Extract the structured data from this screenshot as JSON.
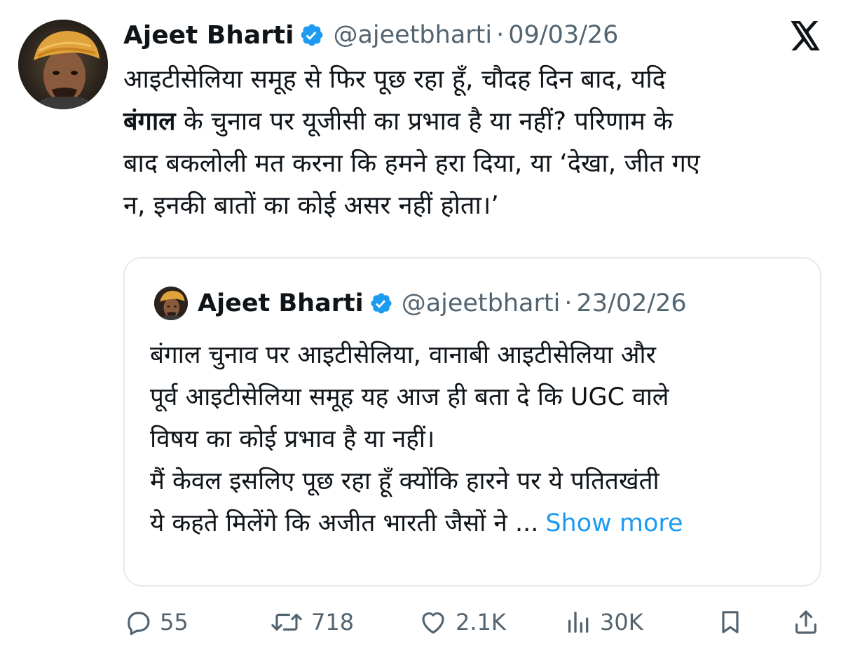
{
  "author": {
    "name": "Ajeet Bharti",
    "handle": "@ajeetbharti",
    "separator": "·",
    "date": "09/03/26"
  },
  "icons": {
    "avatar": "avatar",
    "verified": "verified-badge-icon",
    "platform": "x-logo-icon"
  },
  "colors": {
    "accent": "#1d9bf0",
    "muted": "#536471",
    "text": "#0f1419",
    "border": "#e6e9ec"
  },
  "tweet": {
    "line1": "आइटीसेलिया समूह से फिर पूछ रहा हूँ, चौदह दिन बाद, यदि",
    "line2_bold": "बंगाल",
    "line2_rest": " के चुनाव पर यूजीसी का प्रभाव है या नहीं? परिणाम के",
    "line3": "बाद बकलोली मत करना कि हमने हरा दिया, या ‘देखा, जीत गए",
    "line4": "न, इनकी बातों का कोई असर नहीं होता।’"
  },
  "quote": {
    "name": "Ajeet Bharti",
    "handle": "@ajeetbharti",
    "separator": "·",
    "date": "23/02/26",
    "lines": [
      "बंगाल चुनाव पर आइटीसेलिया, वानाबी आइटीसेलिया और",
      "पूर्व आइटीसेलिया समूह यह आज ही बता दे कि UGC वाले",
      "विषय का कोई प्रभाव है या नहीं।",
      "मैं केवल इसलिए पूछ रहा हूँ क्योंकि हारने पर ये पतितखंती",
      "ये कहते मिलेंगे कि अजीत भारती जैसों ने ..."
    ],
    "show_more": "Show more"
  },
  "actions": {
    "replies": "55",
    "reposts": "718",
    "likes": "2.1K",
    "views": "30K"
  }
}
